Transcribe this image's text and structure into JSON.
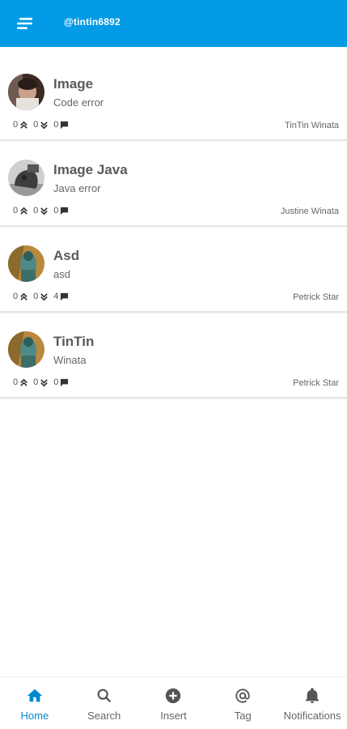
{
  "header": {
    "username": "@tintin6892",
    "accent": "#039be5"
  },
  "posts": [
    {
      "title": "Image",
      "subtitle": "Code error",
      "upvotes": "0",
      "downvotes": "0",
      "comments": "0",
      "author": "TinTin Winata",
      "avatar_icon": "person-photo"
    },
    {
      "title": "Image Java",
      "subtitle": "Java error",
      "upvotes": "0",
      "downvotes": "0",
      "comments": "0",
      "author": "Justine Winata",
      "avatar_icon": "pet-photo"
    },
    {
      "title": "Asd",
      "subtitle": "asd",
      "upvotes": "0",
      "downvotes": "0",
      "comments": "4",
      "author": "Petrick Star",
      "avatar_icon": "art-photo"
    },
    {
      "title": "TinTin",
      "subtitle": "Winata",
      "upvotes": "0",
      "downvotes": "0",
      "comments": "0",
      "author": "Petrick Star",
      "avatar_icon": "art-photo"
    }
  ],
  "nav": {
    "items": [
      {
        "label": "Home",
        "icon": "home-icon",
        "active": true
      },
      {
        "label": "Search",
        "icon": "search-icon",
        "active": false
      },
      {
        "label": "Insert",
        "icon": "add-circle-icon",
        "active": false
      },
      {
        "label": "Tag",
        "icon": "at-icon",
        "active": false
      },
      {
        "label": "Notifications",
        "icon": "bell-icon",
        "active": false
      }
    ],
    "active_color": "#0288d1"
  }
}
